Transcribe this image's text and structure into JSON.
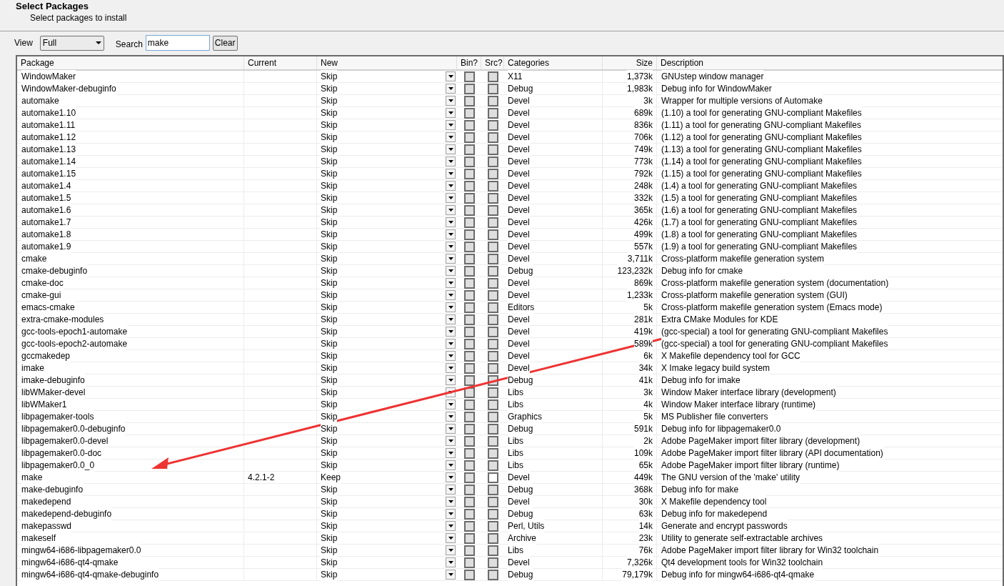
{
  "header": {
    "title": "Select Packages",
    "subtitle": "Select packages to install"
  },
  "toolbar": {
    "view_label": "View",
    "view_value": "Full",
    "search_label": "Search",
    "search_value": "make",
    "clear_button": "Clear"
  },
  "table": {
    "columns": [
      "Package",
      "Current",
      "New",
      "Bin?",
      "Src?",
      "Categories",
      "Size",
      "Description"
    ],
    "rows": [
      {
        "package": "WindowMaker",
        "current": "",
        "new": "Skip",
        "bin_disabled": true,
        "src_disabled": true,
        "categories": "X11",
        "size": "1,373k",
        "description": "GNUstep window manager"
      },
      {
        "package": "WindowMaker-debuginfo",
        "current": "",
        "new": "Skip",
        "bin_disabled": true,
        "src_disabled": true,
        "categories": "Debug",
        "size": "1,983k",
        "description": "Debug info for WindowMaker"
      },
      {
        "package": "automake",
        "current": "",
        "new": "Skip",
        "bin_disabled": true,
        "src_disabled": true,
        "categories": "Devel",
        "size": "3k",
        "description": "Wrapper for multiple versions of Automake"
      },
      {
        "package": "automake1.10",
        "current": "",
        "new": "Skip",
        "bin_disabled": true,
        "src_disabled": true,
        "categories": "Devel",
        "size": "689k",
        "description": "(1.10) a tool for generating GNU-compliant Makefiles"
      },
      {
        "package": "automake1.11",
        "current": "",
        "new": "Skip",
        "bin_disabled": true,
        "src_disabled": true,
        "categories": "Devel",
        "size": "836k",
        "description": "(1.11) a tool for generating GNU-compliant Makefiles"
      },
      {
        "package": "automake1.12",
        "current": "",
        "new": "Skip",
        "bin_disabled": true,
        "src_disabled": true,
        "categories": "Devel",
        "size": "706k",
        "description": "(1.12) a tool for generating GNU-compliant Makefiles"
      },
      {
        "package": "automake1.13",
        "current": "",
        "new": "Skip",
        "bin_disabled": true,
        "src_disabled": true,
        "categories": "Devel",
        "size": "749k",
        "description": "(1.13) a tool for generating GNU-compliant Makefiles"
      },
      {
        "package": "automake1.14",
        "current": "",
        "new": "Skip",
        "bin_disabled": true,
        "src_disabled": true,
        "categories": "Devel",
        "size": "773k",
        "description": "(1.14) a tool for generating GNU-compliant Makefiles"
      },
      {
        "package": "automake1.15",
        "current": "",
        "new": "Skip",
        "bin_disabled": true,
        "src_disabled": true,
        "categories": "Devel",
        "size": "792k",
        "description": "(1.15) a tool for generating GNU-compliant Makefiles"
      },
      {
        "package": "automake1.4",
        "current": "",
        "new": "Skip",
        "bin_disabled": true,
        "src_disabled": true,
        "categories": "Devel",
        "size": "248k",
        "description": "(1.4) a tool for generating GNU-compliant Makefiles"
      },
      {
        "package": "automake1.5",
        "current": "",
        "new": "Skip",
        "bin_disabled": true,
        "src_disabled": true,
        "categories": "Devel",
        "size": "332k",
        "description": "(1.5) a tool for generating GNU-compliant Makefiles"
      },
      {
        "package": "automake1.6",
        "current": "",
        "new": "Skip",
        "bin_disabled": true,
        "src_disabled": true,
        "categories": "Devel",
        "size": "365k",
        "description": "(1.6) a tool for generating GNU-compliant Makefiles"
      },
      {
        "package": "automake1.7",
        "current": "",
        "new": "Skip",
        "bin_disabled": true,
        "src_disabled": true,
        "categories": "Devel",
        "size": "426k",
        "description": "(1.7) a tool for generating GNU-compliant Makefiles"
      },
      {
        "package": "automake1.8",
        "current": "",
        "new": "Skip",
        "bin_disabled": true,
        "src_disabled": true,
        "categories": "Devel",
        "size": "499k",
        "description": "(1.8) a tool for generating GNU-compliant Makefiles"
      },
      {
        "package": "automake1.9",
        "current": "",
        "new": "Skip",
        "bin_disabled": true,
        "src_disabled": true,
        "categories": "Devel",
        "size": "557k",
        "description": "(1.9) a tool for generating GNU-compliant Makefiles"
      },
      {
        "package": "cmake",
        "current": "",
        "new": "Skip",
        "bin_disabled": true,
        "src_disabled": true,
        "categories": "Devel",
        "size": "3,711k",
        "description": "Cross-platform makefile generation system"
      },
      {
        "package": "cmake-debuginfo",
        "current": "",
        "new": "Skip",
        "bin_disabled": true,
        "src_disabled": true,
        "categories": "Debug",
        "size": "123,232k",
        "description": "Debug info for cmake"
      },
      {
        "package": "cmake-doc",
        "current": "",
        "new": "Skip",
        "bin_disabled": true,
        "src_disabled": true,
        "categories": "Devel",
        "size": "869k",
        "description": "Cross-platform makefile generation system (documentation)"
      },
      {
        "package": "cmake-gui",
        "current": "",
        "new": "Skip",
        "bin_disabled": true,
        "src_disabled": true,
        "categories": "Devel",
        "size": "1,233k",
        "description": "Cross-platform makefile generation system (GUI)"
      },
      {
        "package": "emacs-cmake",
        "current": "",
        "new": "Skip",
        "bin_disabled": true,
        "src_disabled": true,
        "categories": "Editors",
        "size": "5k",
        "description": "Cross-platform makefile generation system (Emacs mode)"
      },
      {
        "package": "extra-cmake-modules",
        "current": "",
        "new": "Skip",
        "bin_disabled": true,
        "src_disabled": true,
        "categories": "Devel",
        "size": "281k",
        "description": "Extra CMake Modules for KDE"
      },
      {
        "package": "gcc-tools-epoch1-automake",
        "current": "",
        "new": "Skip",
        "bin_disabled": true,
        "src_disabled": true,
        "categories": "Devel",
        "size": "419k",
        "description": "(gcc-special) a tool for generating GNU-compliant Makefiles"
      },
      {
        "package": "gcc-tools-epoch2-automake",
        "current": "",
        "new": "Skip",
        "bin_disabled": true,
        "src_disabled": true,
        "categories": "Devel",
        "size": "589k",
        "description": "(gcc-special) a tool for generating GNU-compliant Makefiles"
      },
      {
        "package": "gccmakedep",
        "current": "",
        "new": "Skip",
        "bin_disabled": true,
        "src_disabled": true,
        "categories": "Devel",
        "size": "6k",
        "description": "X Makefile dependency tool for GCC"
      },
      {
        "package": "imake",
        "current": "",
        "new": "Skip",
        "bin_disabled": true,
        "src_disabled": true,
        "categories": "Devel",
        "size": "34k",
        "description": "X Imake legacy build system"
      },
      {
        "package": "imake-debuginfo",
        "current": "",
        "new": "Skip",
        "bin_disabled": true,
        "src_disabled": true,
        "categories": "Debug",
        "size": "41k",
        "description": "Debug info for imake"
      },
      {
        "package": "libWMaker-devel",
        "current": "",
        "new": "Skip",
        "bin_disabled": true,
        "src_disabled": true,
        "categories": "Libs",
        "size": "3k",
        "description": "Window Maker interface library (development)"
      },
      {
        "package": "libWMaker1",
        "current": "",
        "new": "Skip",
        "bin_disabled": true,
        "src_disabled": true,
        "categories": "Libs",
        "size": "4k",
        "description": "Window Maker interface library (runtime)"
      },
      {
        "package": "libpagemaker-tools",
        "current": "",
        "new": "Skip",
        "bin_disabled": true,
        "src_disabled": true,
        "categories": "Graphics",
        "size": "5k",
        "description": "MS Publisher file converters"
      },
      {
        "package": "libpagemaker0.0-debuginfo",
        "current": "",
        "new": "Skip",
        "bin_disabled": true,
        "src_disabled": true,
        "categories": "Debug",
        "size": "591k",
        "description": "Debug info for libpagemaker0.0"
      },
      {
        "package": "libpagemaker0.0-devel",
        "current": "",
        "new": "Skip",
        "bin_disabled": true,
        "src_disabled": true,
        "categories": "Libs",
        "size": "2k",
        "description": "Adobe PageMaker import filter library (development)"
      },
      {
        "package": "libpagemaker0.0-doc",
        "current": "",
        "new": "Skip",
        "bin_disabled": true,
        "src_disabled": true,
        "categories": "Libs",
        "size": "109k",
        "description": "Adobe PageMaker import filter library (API documentation)"
      },
      {
        "package": "libpagemaker0.0_0",
        "current": "",
        "new": "Skip",
        "bin_disabled": true,
        "src_disabled": true,
        "categories": "Libs",
        "size": "65k",
        "description": "Adobe PageMaker import filter library (runtime)"
      },
      {
        "package": "make",
        "current": "4.2.1-2",
        "new": "Keep",
        "bin_disabled": true,
        "src_disabled": false,
        "categories": "Devel",
        "size": "449k",
        "description": "The GNU version of the 'make' utility"
      },
      {
        "package": "make-debuginfo",
        "current": "",
        "new": "Skip",
        "bin_disabled": true,
        "src_disabled": true,
        "categories": "Debug",
        "size": "368k",
        "description": "Debug info for make"
      },
      {
        "package": "makedepend",
        "current": "",
        "new": "Skip",
        "bin_disabled": true,
        "src_disabled": true,
        "categories": "Devel",
        "size": "30k",
        "description": "X Makefile dependency tool"
      },
      {
        "package": "makedepend-debuginfo",
        "current": "",
        "new": "Skip",
        "bin_disabled": true,
        "src_disabled": true,
        "categories": "Debug",
        "size": "63k",
        "description": "Debug info for makedepend"
      },
      {
        "package": "makepasswd",
        "current": "",
        "new": "Skip",
        "bin_disabled": true,
        "src_disabled": true,
        "categories": "Perl, Utils",
        "size": "14k",
        "description": "Generate and encrypt passwords"
      },
      {
        "package": "makeself",
        "current": "",
        "new": "Skip",
        "bin_disabled": true,
        "src_disabled": true,
        "categories": "Archive",
        "size": "23k",
        "description": "Utility to generate self-extractable archives"
      },
      {
        "package": "mingw64-i686-libpagemaker0.0",
        "current": "",
        "new": "Skip",
        "bin_disabled": true,
        "src_disabled": true,
        "categories": "Libs",
        "size": "76k",
        "description": "Adobe PageMaker import filter library for Win32 toolchain"
      },
      {
        "package": "mingw64-i686-qt4-qmake",
        "current": "",
        "new": "Skip",
        "bin_disabled": true,
        "src_disabled": true,
        "categories": "Devel",
        "size": "7,326k",
        "description": "Qt4 development tools for Win32 toolchain"
      },
      {
        "package": "mingw64-i686-qt4-qmake-debuginfo",
        "current": "",
        "new": "Skip",
        "bin_disabled": true,
        "src_disabled": true,
        "categories": "Debug",
        "size": "79,179k",
        "description": "Debug info for mingw64-i686-qt4-qmake"
      }
    ]
  }
}
